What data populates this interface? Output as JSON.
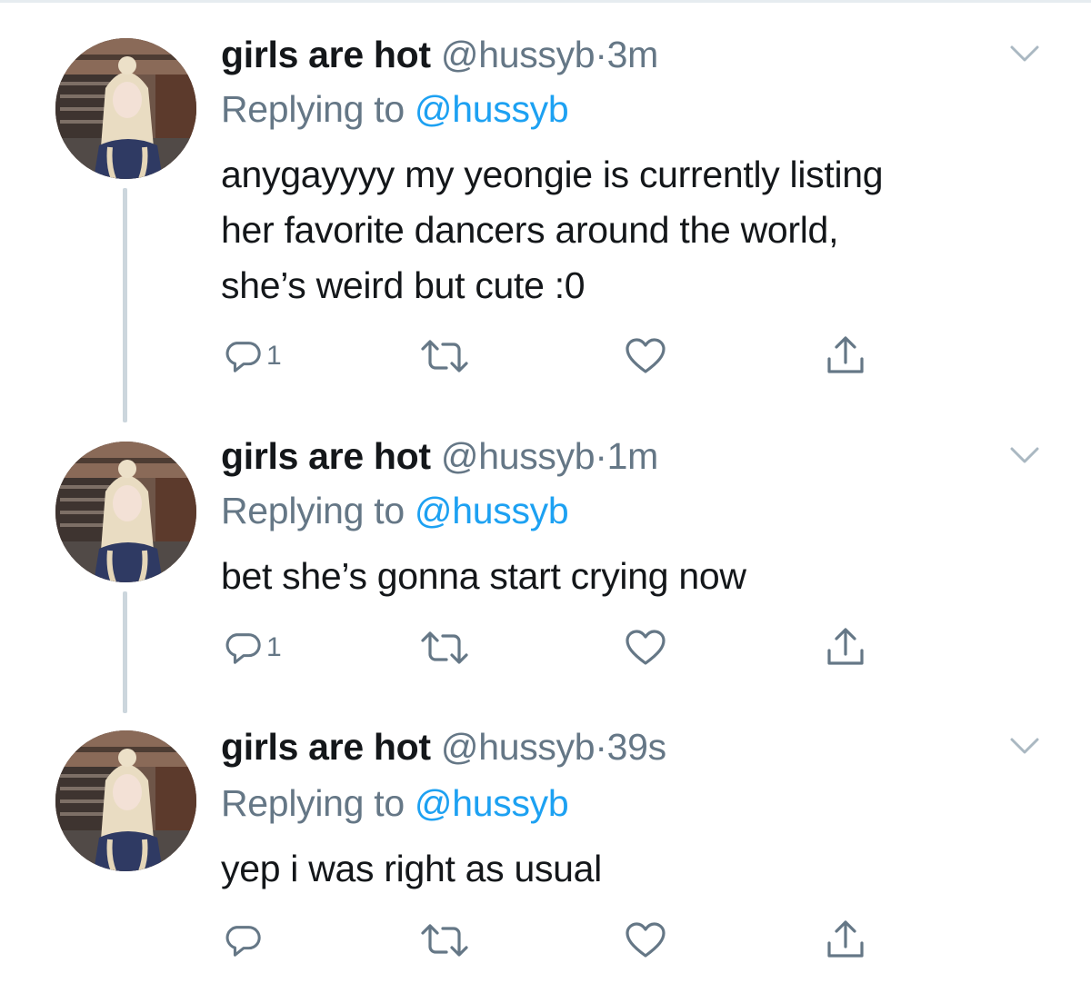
{
  "tweets": [
    {
      "display_name": "girls are hot",
      "handle": "@hussyb",
      "dot": "·",
      "time": "3m",
      "replying_prefix": "Replying to",
      "replying_to": "@hussyb",
      "text_lines": [
        "anygayyyy my yeongie is currently listing",
        "her favorite dancers around the world,",
        "she’s weird but cute :0"
      ],
      "reply_count": "1"
    },
    {
      "display_name": "girls are hot",
      "handle": "@hussyb",
      "dot": "·",
      "time": "1m",
      "replying_prefix": "Replying to",
      "replying_to": "@hussyb",
      "text_lines": [
        "bet she’s gonna start crying now"
      ],
      "reply_count": "1"
    },
    {
      "display_name": "girls are hot",
      "handle": "@hussyb",
      "dot": "·",
      "time": "39s",
      "replying_prefix": "Replying to",
      "replying_to": "@hussyb",
      "text_lines": [
        "yep i was right as usual"
      ],
      "reply_count": ""
    }
  ],
  "icons": {
    "reply": "reply-icon",
    "retweet": "retweet-icon",
    "like": "heart-icon",
    "share": "share-icon",
    "more": "chevron-down-icon"
  },
  "colors": {
    "text": "#14171a",
    "secondary": "#657786",
    "link": "#1da1f2",
    "icon": "#657786",
    "thread_line": "#ccd6dd"
  }
}
